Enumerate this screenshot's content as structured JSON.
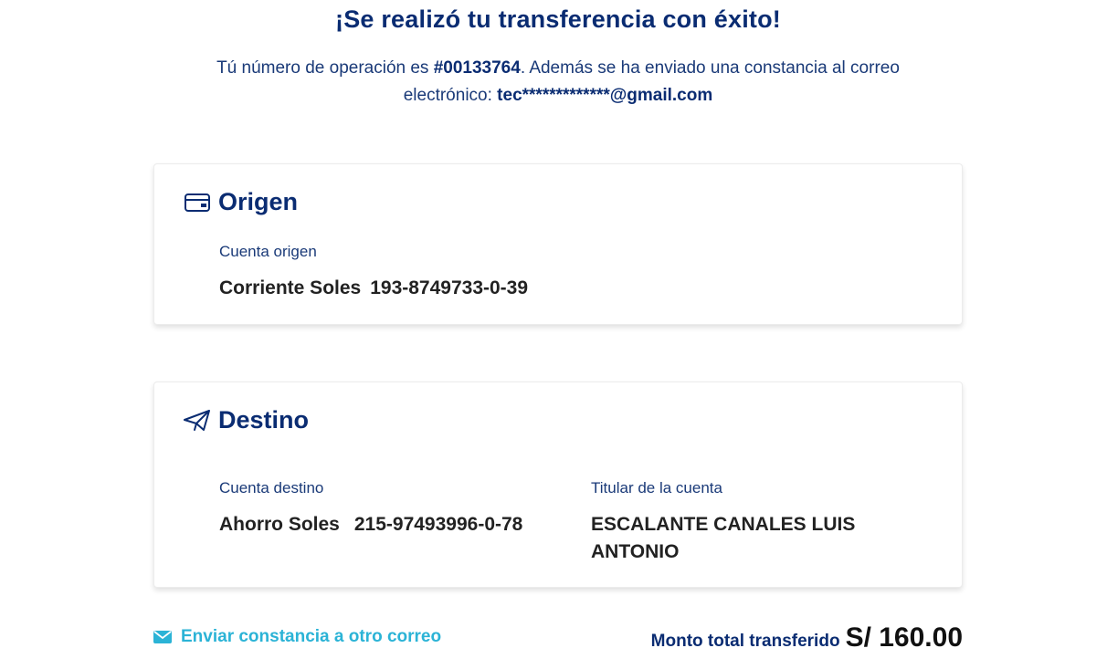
{
  "header": {
    "title": "¡Se realizó tu transferencia con éxito!",
    "op_prefix": "Tú número de operación es ",
    "op_number": "#00133764",
    "op_suffix": ". Además se ha enviado una constancia al correo electrónico: ",
    "email": "tec*************@gmail.com"
  },
  "origen": {
    "title": "Origen",
    "icon": "credit-card-icon",
    "account_label": "Cuenta origen",
    "account_type": "Corriente Soles",
    "account_number": "193-8749733-0-39"
  },
  "destino": {
    "title": "Destino",
    "icon": "paper-plane-icon",
    "account_label": "Cuenta destino",
    "account_type": "Ahorro Soles",
    "account_number": "215-97493996-0-78",
    "holder_label": "Titular de la cuenta",
    "holder_name": "ESCALANTE CANALES LUIS ANTONIO"
  },
  "footer": {
    "send_link": "Enviar constancia a otro correo",
    "send_icon": "mail-icon",
    "total_label": "Monto total transferido",
    "total_amount": "S/ 160.00"
  },
  "colors": {
    "brand_blue": "#0a2c72",
    "link_cyan": "#2bb3d6"
  }
}
